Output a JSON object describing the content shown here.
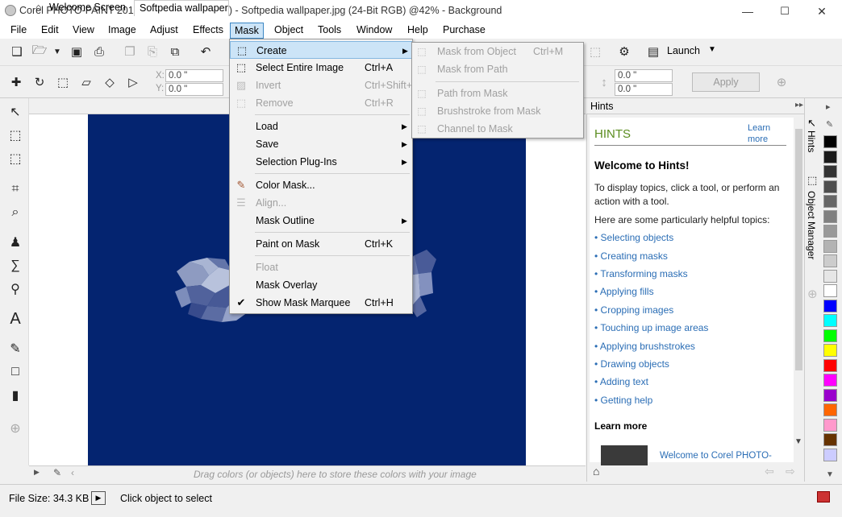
{
  "window": {
    "title": "Corel PHOTO-PAINT 2017 (Evaluation Version) - Softpedia wallpaper.jpg (24-Bit RGB) @42% - Background",
    "minimize": "—",
    "restore": "☐",
    "close": "✕"
  },
  "menubar": [
    "File",
    "Edit",
    "View",
    "Image",
    "Adjust",
    "Effects",
    "Mask",
    "Object",
    "Tools",
    "Window",
    "Help",
    "Purchase"
  ],
  "toolbar": {
    "launch_label": "Launch",
    "apply_label": "Apply",
    "x_label": "X:",
    "y_label": "Y:",
    "x_value": "0.0 \"",
    "y_value": "0.0 \"",
    "w_value": "0.0 \"",
    "h_value": "0.0 \""
  },
  "doc_tabs": [
    "Welcome Screen",
    "Softpedia wallpaper.jpg"
  ],
  "mask_menu": [
    {
      "label": "Create",
      "shortcut": "",
      "submenu": true,
      "disabled": false,
      "highlight": true
    },
    {
      "label": "Select Entire Image",
      "shortcut": "Ctrl+A",
      "submenu": false,
      "disabled": false
    },
    {
      "label": "Invert",
      "shortcut": "Ctrl+Shift+I",
      "submenu": false,
      "disabled": true
    },
    {
      "label": "Remove",
      "shortcut": "Ctrl+R",
      "submenu": false,
      "disabled": true
    },
    {
      "label": "Load",
      "shortcut": "",
      "submenu": true,
      "disabled": false
    },
    {
      "label": "Save",
      "shortcut": "",
      "submenu": true,
      "disabled": false
    },
    {
      "label": "Selection Plug-Ins",
      "shortcut": "",
      "submenu": true,
      "disabled": false
    },
    {
      "label": "Color Mask...",
      "shortcut": "",
      "submenu": false,
      "disabled": false
    },
    {
      "label": "Align...",
      "shortcut": "",
      "submenu": false,
      "disabled": true
    },
    {
      "label": "Mask Outline",
      "shortcut": "",
      "submenu": true,
      "disabled": false
    },
    {
      "label": "Paint on Mask",
      "shortcut": "Ctrl+K",
      "submenu": false,
      "disabled": false
    },
    {
      "label": "Float",
      "shortcut": "",
      "submenu": false,
      "disabled": true
    },
    {
      "label": "Mask Overlay",
      "shortcut": "",
      "submenu": false,
      "disabled": false
    },
    {
      "label": "Show Mask Marquee",
      "shortcut": "Ctrl+H",
      "submenu": false,
      "disabled": false,
      "checked": true
    }
  ],
  "create_menu": [
    {
      "label": "Mask from Object",
      "shortcut": "Ctrl+M"
    },
    {
      "label": "Mask from Path",
      "shortcut": ""
    },
    {
      "label": "Path from Mask",
      "shortcut": ""
    },
    {
      "label": "Brushstroke from Mask",
      "shortcut": ""
    },
    {
      "label": "Channel to Mask",
      "shortcut": ""
    }
  ],
  "hints": {
    "panel_title": "Hints",
    "heading": "HINTS",
    "learn_more_link": "Learn more",
    "welcome": "Welcome to Hints!",
    "description": "To display topics, click a tool, or perform an action with a tool.",
    "topics_intro": "Here are some particularly helpful topics:",
    "topics": [
      "Selecting objects",
      "Creating masks",
      "Transforming masks",
      "Applying fills",
      "Cropping images",
      "Touching up image areas",
      "Applying brushstrokes",
      "Drawing objects",
      "Adding text",
      "Getting help"
    ],
    "learn_more_heading": "Learn more",
    "video_link": "Welcome to Corel PHOTO-"
  },
  "side_tabs": [
    "Hints",
    "Object Manager"
  ],
  "color_tray_hint": "Drag colors (or objects) here to store these colors with your image",
  "palette": [
    "#000000",
    "#1a1a1a",
    "#333333",
    "#4d4d4d",
    "#666666",
    "#808080",
    "#999999",
    "#b3b3b3",
    "#cccccc",
    "#e6e6e6",
    "#ffffff",
    "#0000ff",
    "#00ffff",
    "#00ff00",
    "#ffff00",
    "#ff0000",
    "#ff00ff",
    "#9900cc",
    "#ff6600",
    "#ff99cc",
    "#663300",
    "#ccccff"
  ],
  "status": {
    "file_size": "File Size: 34.3 KB",
    "message": "Click object to select"
  }
}
